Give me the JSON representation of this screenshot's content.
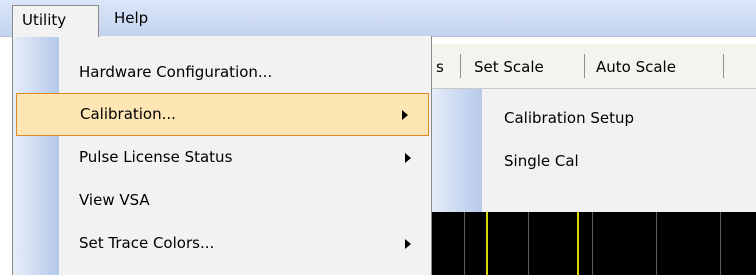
{
  "menubar": {
    "utility": "Utility",
    "help": "Help"
  },
  "toolbar": {
    "partial": "s",
    "set_scale": "Set Scale",
    "auto_scale": "Auto Scale"
  },
  "utility_menu": {
    "items": [
      {
        "label": "Hardware Configuration...",
        "has_submenu": false,
        "highlighted": false
      },
      {
        "label": "Calibration...",
        "has_submenu": true,
        "highlighted": true
      },
      {
        "label": "Pulse License Status",
        "has_submenu": true,
        "highlighted": false
      },
      {
        "label": "View VSA",
        "has_submenu": false,
        "highlighted": false
      },
      {
        "label": "Set Trace Colors...",
        "has_submenu": true,
        "highlighted": false
      }
    ]
  },
  "calibration_submenu": {
    "items": [
      {
        "label": "Calibration Setup"
      },
      {
        "label": "Single Cal"
      }
    ]
  },
  "colors": {
    "highlight_fill": "#fde6b4",
    "highlight_border": "#e08a26",
    "scope_background": "#000000",
    "trace": "#d8d800"
  }
}
